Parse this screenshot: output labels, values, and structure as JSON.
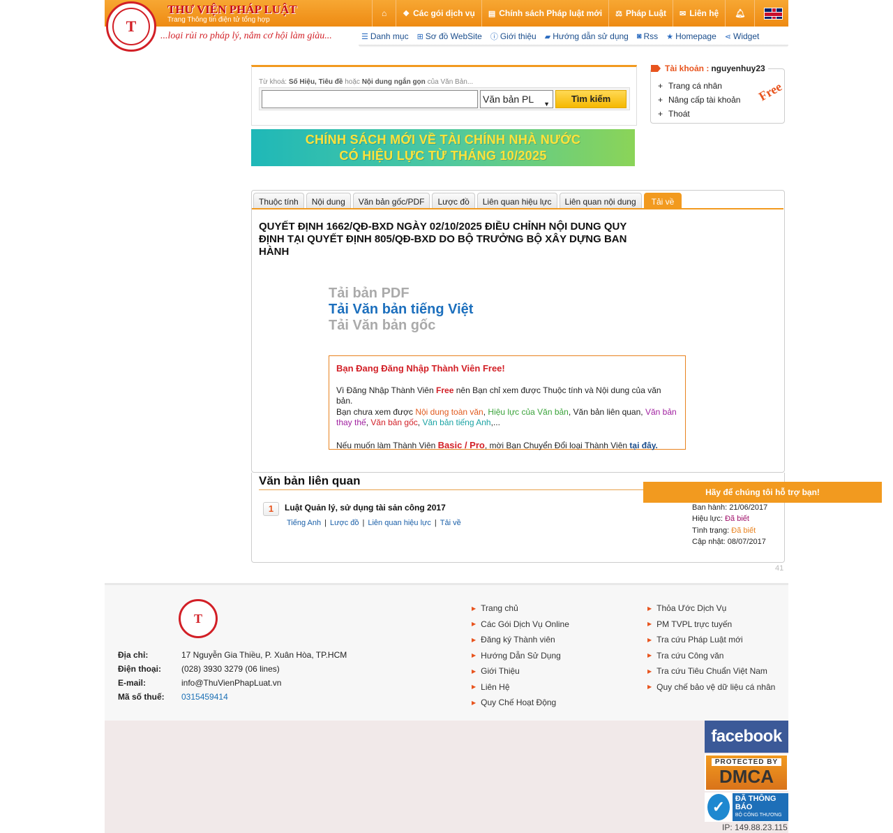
{
  "header": {
    "site_title": "THƯ VIỆN PHÁP LUẬT",
    "site_subtitle": "Trang Thông tin điện tử tổng hợp",
    "slogan": "...loại rủi ro pháp lý, nắm cơ hội làm giàu...",
    "logo_letter": "T",
    "topnav": {
      "home_icon": "⌂",
      "packages": "Các gói dịch vụ",
      "new_policy": "Chính sách Pháp luật mới",
      "law": "Pháp Luật",
      "contact": "Liên hệ",
      "bell_icon": "🔔"
    },
    "subnav": {
      "catalog": "Danh mục",
      "sitemap": "Sơ đồ WebSite",
      "about": "Giới thiệu",
      "guide": "Hướng dẫn sử dụng",
      "rss": "Rss",
      "homepage": "Homepage",
      "widget": "Widget"
    }
  },
  "search": {
    "hint_prefix": "Từ khoá:",
    "hint_bold1": "Số Hiệu, Tiêu đề",
    "hint_mid": "hoặc",
    "hint_bold2": "Nội dung ngắn gọn",
    "hint_suffix": "của Văn Bản...",
    "query": "",
    "select_value": "Văn bản PL",
    "button": "Tìm kiếm"
  },
  "banner": {
    "line1": "CHÍNH SÁCH MỚI VỀ TÀI CHÍNH NHÀ NƯỚC",
    "line2": "CÓ HIỆU LỰC TỪ THÁNG 10/2025"
  },
  "account": {
    "label": "Tài khoản :",
    "username": "nguyenhuy23",
    "items": [
      "Trang cá nhân",
      "Nâng cấp tài khoản",
      "Thoát"
    ],
    "badge": "Free"
  },
  "tabs": [
    "Thuộc tính",
    "Nội dung",
    "Văn bản gốc/PDF",
    "Lược đồ",
    "Liên quan hiệu lực",
    "Liên quan nội dung",
    "Tải về"
  ],
  "document": {
    "title": "QUYẾT ĐỊNH 1662/QĐ-BXD NGÀY 02/10/2025 ĐIỀU CHỈNH NỘI DUNG QUY ĐỊNH TẠI QUYẾT ĐỊNH 805/QĐ-BXD DO BỘ TRƯỞNG BỘ XÂY DỰNG BAN HÀNH",
    "download_pdf": "Tải bản PDF",
    "download_vi": "Tải Văn bản tiếng Việt",
    "download_original": "Tải Văn bản gốc"
  },
  "notice": {
    "heading": "Bạn Đang Đăng Nhập Thành Viên Free!",
    "l1_a": "Vì Đăng Nhập Thành Viên",
    "l1_free": "Free",
    "l1_b": "nên Bạn chỉ xem được Thuộc tính và Nội dung của văn bản.",
    "l2_a": "Bạn chưa xem được",
    "l2_full": "Nội dung toàn văn",
    "l2_sep1": ",",
    "l2_effect": "Hiệu lực của Văn bản",
    "l2_b": ", Văn bản liên quan,",
    "l2_replace": "Văn bản thay thế",
    "l2_sep2": ",",
    "l2_original": "Văn bản gốc",
    "l2_sep3": ",",
    "l2_english": "Văn bản tiếng Anh",
    "l2_end": ",...",
    "l3_a": "Nếu muốn làm Thành Viên",
    "l3_plan": "Basic / Pro",
    "l3_b": ", mời Bạn Chuyển Đổi loại Thành Viên",
    "l3_link": "tại đây."
  },
  "related": {
    "title": "Văn bản liên quan",
    "items": [
      {
        "num": "1",
        "name": "Luật Quản lý, sử dụng tài sản công 2017",
        "links": [
          "Tiếng Anh",
          "Lược đồ",
          "Liên quan hiệu lực",
          "Tải về"
        ],
        "issued_label": "Ban hành:",
        "issued": "21/06/2017",
        "effect_label": "Hiệu lực:",
        "effect": "Đã biết",
        "status_label": "Tình trạng:",
        "status": "Đã biết",
        "updated_label": "Cập nhật:",
        "updated": "08/07/2017"
      }
    ]
  },
  "support": "Hãy để chúng tôi hỗ trợ bạn!",
  "page_num": "41",
  "footer": {
    "address_label": "Địa chỉ:",
    "address": "17 Nguyễn Gia Thiều, P. Xuân Hòa, TP.HCM",
    "phone_label": "Điện thoại:",
    "phone": "(028) 3930 3279 (06 lines)",
    "email_label": "E-mail:",
    "email": "info@ThuVienPhapLuat.vn",
    "tax_label": "Mã số thuế:",
    "tax": "0315459414",
    "col1": [
      "Trang chủ",
      "Các Gói Dịch Vụ Online",
      "Đăng ký Thành viên",
      "Hướng Dẫn Sử Dụng",
      "Giới Thiệu",
      "Liên Hệ",
      "Quy Chế Hoạt Động"
    ],
    "col2": [
      "Thỏa Ước Dịch Vụ",
      "PM TVPL trực tuyến",
      "Tra cứu Pháp Luật mới",
      "Tra cứu Công văn",
      "Tra cứu Tiêu Chuẩn Việt Nam",
      "Quy chế bảo vệ dữ liệu cá nhân"
    ],
    "facebook": "facebook",
    "dmca_top": "PROTECTED BY",
    "dmca": "DMCA",
    "bct_main": "ĐÃ THÔNG BÁO",
    "bct_sub": "BỘ CÔNG THƯƠNG",
    "ip": "IP: 149.88.23.115"
  }
}
